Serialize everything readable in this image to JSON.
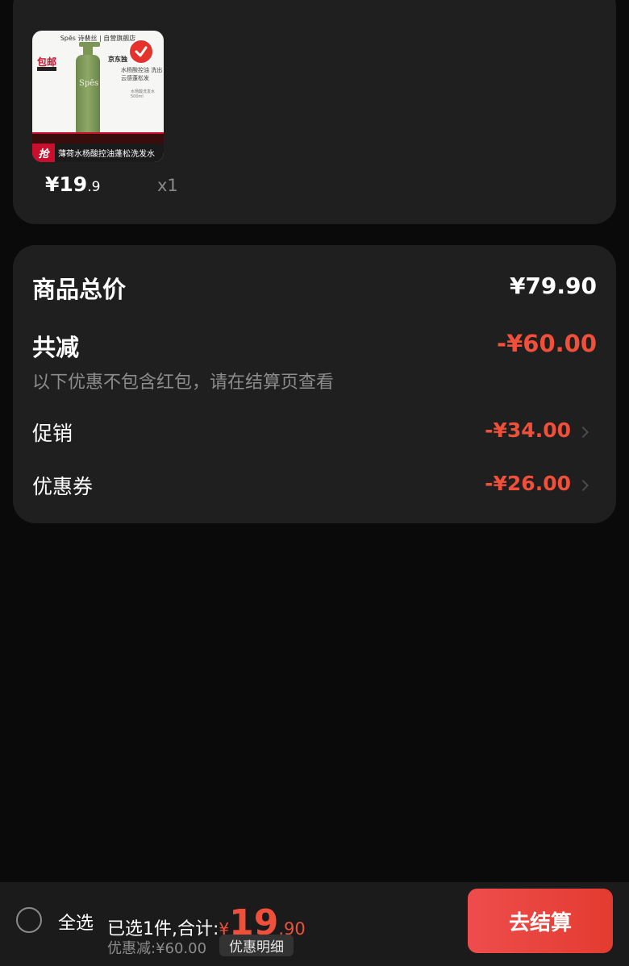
{
  "product": {
    "thumbnail": {
      "brand_text": "Spēs 诗裴丝  |  自营旗舰店",
      "free_shipping": "包邮",
      "bottle_label": "Spēs",
      "tag_primary": "京东独",
      "tag_secondary": "水杨酸控油 洗出云感蓬松发",
      "tag_tiny": "水杨酸洗发水 500ml",
      "grab_badge": "抢",
      "banner_text": "薄荷水杨酸控油蓬松洗发水"
    },
    "price_symbol": "¥",
    "price_int": "19",
    "price_dec": ".9",
    "quantity": "x1",
    "selected": true
  },
  "summary": {
    "total_label": "商品总价",
    "total_value": "¥79.90",
    "reduce_label": "共减",
    "reduce_value": "-¥60.00",
    "hint": "以下优惠不包含红包，请在结算页查看",
    "promo_label": "促销",
    "promo_value": "-¥34.00",
    "coupon_label": "优惠券",
    "coupon_value": "-¥26.00"
  },
  "bottom_bar": {
    "select_all_label": "全选",
    "selected_text": "已选1件,合计:",
    "total_symbol": "¥",
    "total_int": "19",
    "total_dec": ".90",
    "discount_text": "优惠减:¥60.00",
    "detail_button": "优惠明细",
    "checkout_button": "去结算"
  },
  "colors": {
    "accent_red": "#f0503a",
    "checkout_gradient_start": "#ee4d4d",
    "checkout_gradient_end": "#e33b2f",
    "card_bg": "#1f1f1f",
    "page_bg": "#0a0a0a"
  }
}
